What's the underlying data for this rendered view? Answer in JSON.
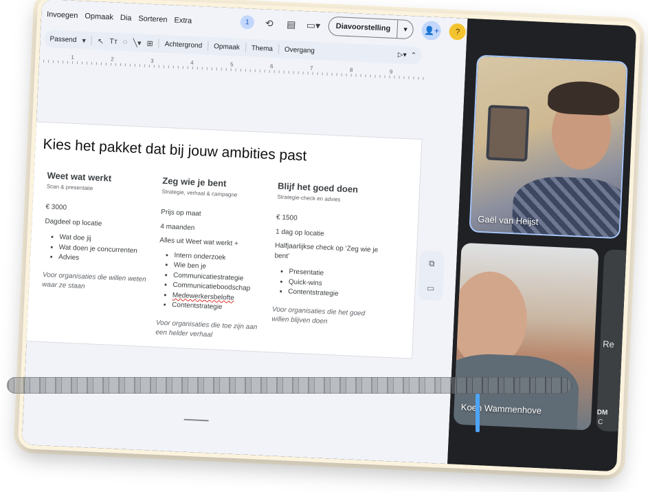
{
  "menu": [
    "Invoegen",
    "Opmaak",
    "Dia",
    "Sorteren",
    "Extra"
  ],
  "toolbar": {
    "zoom": "Passend",
    "items": [
      "Achtergrond",
      "Opmaak",
      "Thema",
      "Overgang"
    ]
  },
  "topbar": {
    "comments_count": "1",
    "slideshow_label": "Diavoorstelling"
  },
  "ruler_ticks": [
    "1",
    "2",
    "3",
    "4",
    "5",
    "6",
    "7",
    "8",
    "9"
  ],
  "slide": {
    "title": "Kies het pakket dat bij jouw ambities past",
    "columns": [
      {
        "heading": "Weet wat werkt",
        "subheading": "Scan & presentatie",
        "price": "€ 3000",
        "duration": "Dagdeel op locatie",
        "bullets": [
          "Wat doe jij",
          "Wat doen je concurrenten",
          "Advies"
        ],
        "note": "Voor organisaties die willen weten waar ze staan"
      },
      {
        "heading": "Zeg wie je bent",
        "subheading": "Strategie, verhaal & campagne",
        "price": "Prijs op maat",
        "duration": "4 maanden",
        "intro": "Alles uit Weet wat werkt +",
        "bullets": [
          "Intern onderzoek",
          "Wie ben je",
          "Communicatiestrategie",
          "Communicatieboodschap",
          "Medewerkersbelofte",
          "Contentstrategie"
        ],
        "note": "Voor organisaties die toe zijn aan een helder verhaal"
      },
      {
        "heading": "Blijf het goed doen",
        "subheading": "Strategie-check en advies",
        "price": "€ 1500",
        "duration": "1 dag op locatie",
        "intro": "Halfjaarlijkse check op ‘Zeg wie je bent’",
        "bullets": [
          "Presentatie",
          "Quick-wins",
          "Contentstrategie"
        ],
        "note": "Voor organisaties die het goed willen blijven doen"
      }
    ]
  },
  "participants": [
    {
      "name": "Gaël van Heijst"
    },
    {
      "name": "Koen Wammenhove"
    }
  ],
  "cut_texts": [
    "Re",
    "DM",
    "C"
  ]
}
